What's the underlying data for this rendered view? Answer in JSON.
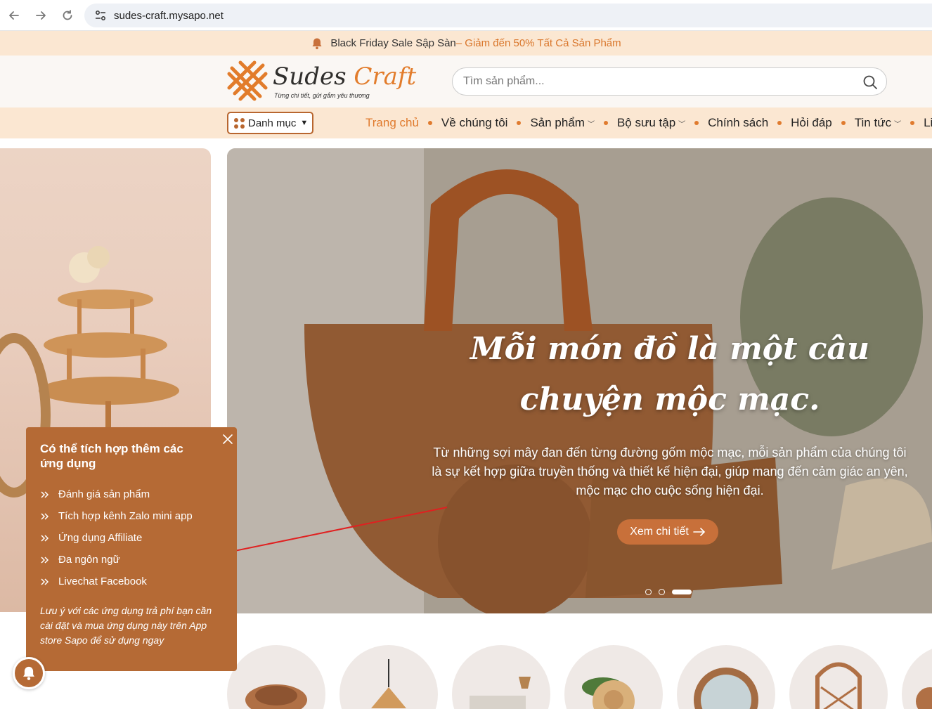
{
  "browser": {
    "url": "sudes-craft.mysapo.net"
  },
  "announce": {
    "text": "Black Friday Sale Sập Sàn",
    "highlight": " – Giảm đến 50% Tất Cả Sản Phẩm"
  },
  "header": {
    "logo_name": "Sudes",
    "logo_name_accent": "Craft",
    "logo_tagline": "Từng chi tiết, gửi gắm yêu thương",
    "search_placeholder": "Tìm sản phẩm..."
  },
  "nav": {
    "category_button": "Danh mục",
    "items": [
      {
        "label": "Trang chủ"
      },
      {
        "label": "Về chúng tôi"
      },
      {
        "label": "Sản phẩm"
      },
      {
        "label": "Bộ sưu tập"
      },
      {
        "label": "Chính sách"
      },
      {
        "label": "Hỏi đáp"
      },
      {
        "label": "Tin tức"
      },
      {
        "label": "Liê"
      }
    ]
  },
  "hero": {
    "title": "Mỗi món đồ là một câu chuyện mộc mạc.",
    "subtitle": "Từ những sợi mây đan đến từng đường gốm mộc mạc, mỗi sản phẩm của chúng tôi là sự kết hợp giữa truyền thống và thiết kế hiện đại, giúp mang đến cảm giác an yên, mộc mạc cho cuộc sống hiện đại.",
    "button": "Xem chi tiết"
  },
  "popup": {
    "title": "Có thể tích hợp thêm các ứng dụng",
    "items": [
      {
        "label": "Đánh giá sản phẩm"
      },
      {
        "label": "Tích hợp kênh Zalo mini app"
      },
      {
        "label": "Ứng dụng Affiliate"
      },
      {
        "label": "Đa ngôn ngữ"
      },
      {
        "label": "Livechat Facebook"
      }
    ],
    "note": "Lưu ý với các ứng dụng trả phí bạn cần cài đặt và mua ứng dụng này trên App store Sapo để sử dụng ngay"
  },
  "colors": {
    "accent": "#e07b2e",
    "popup_bg": "#b56a35",
    "announce_bg": "#fbe7d2"
  }
}
